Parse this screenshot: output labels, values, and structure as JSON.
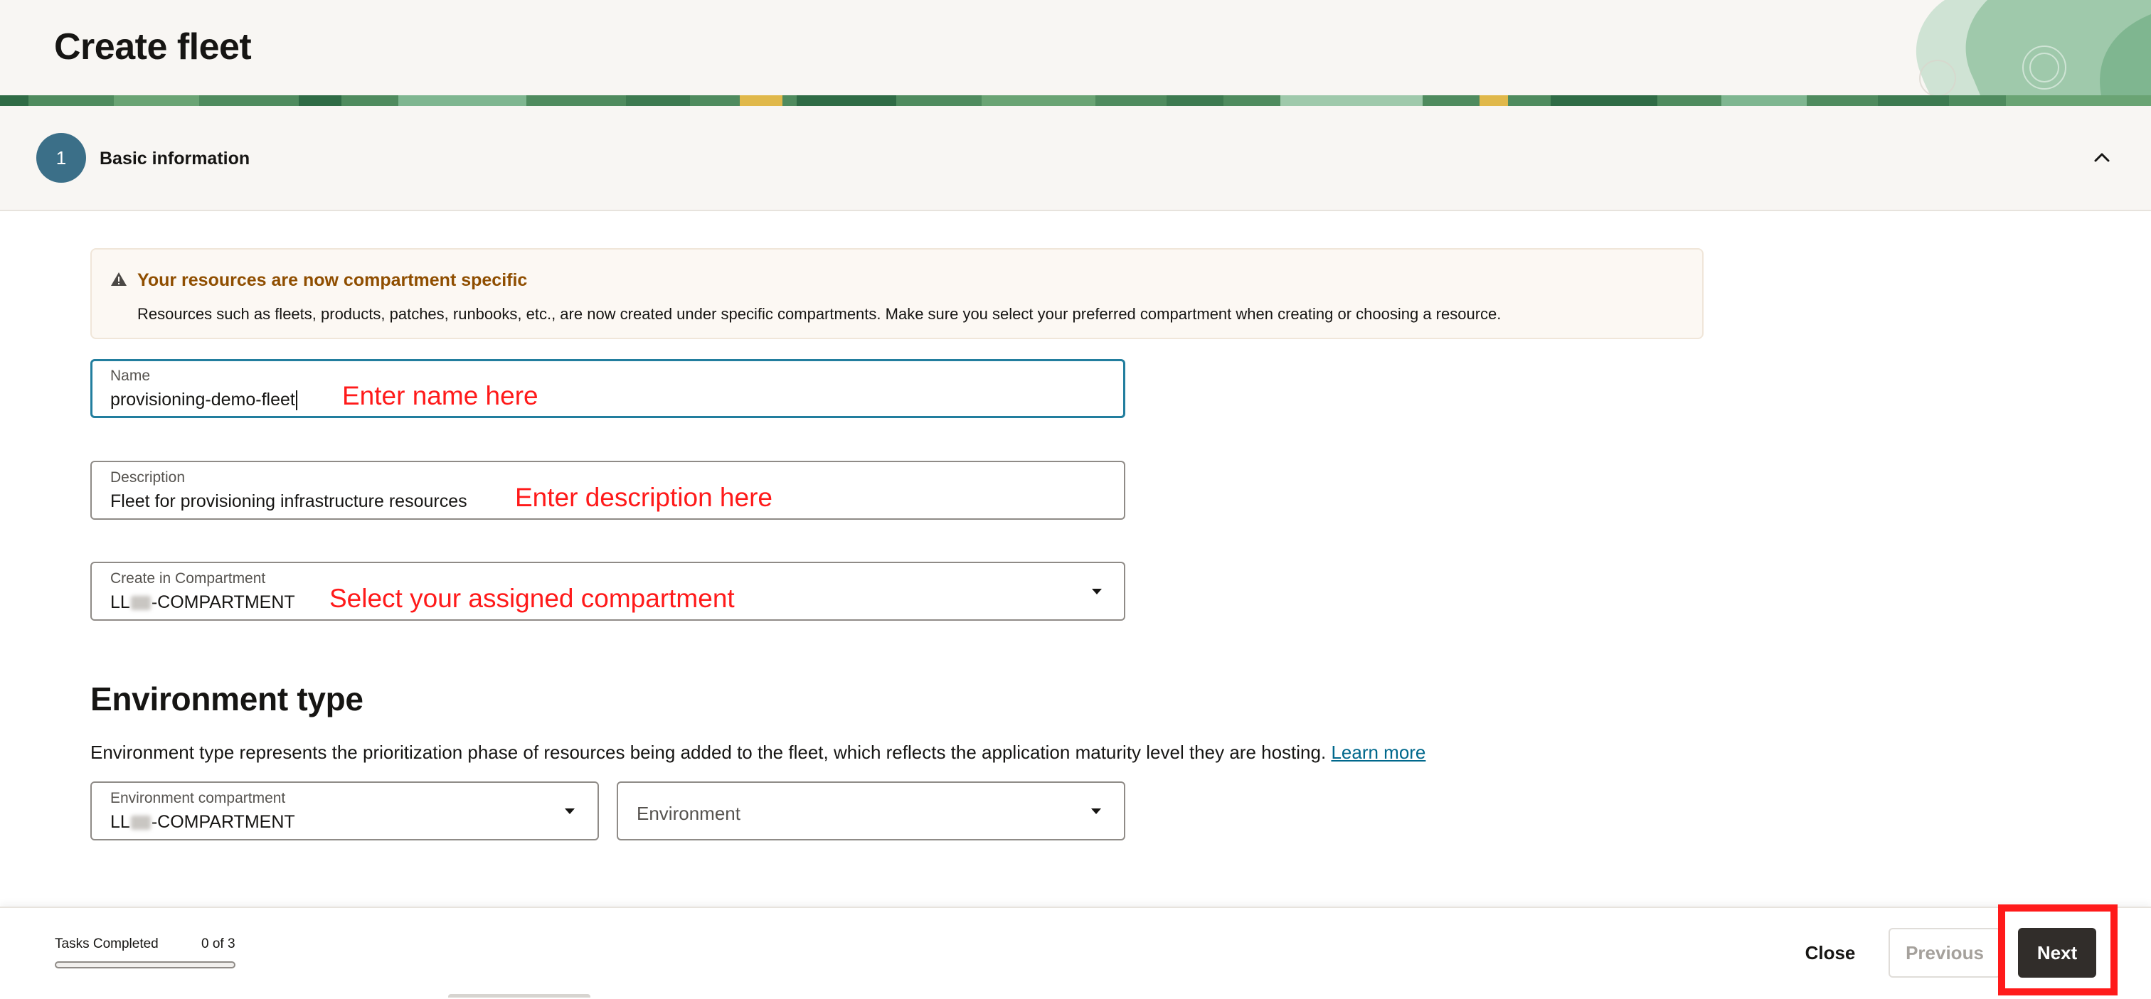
{
  "page": {
    "title": "Create fleet"
  },
  "step": {
    "number": "1",
    "title": "Basic information"
  },
  "alert": {
    "title": "Your resources are now compartment specific",
    "body": "Resources such as fleets, products, patches, runbooks, etc., are now created under specific compartments. Make sure you select your preferred compartment when creating or choosing a resource."
  },
  "form": {
    "name": {
      "label": "Name",
      "value": "provisioning-demo-fleet",
      "annotation": "Enter name here"
    },
    "description": {
      "label": "Description",
      "value": "Fleet for provisioning infrastructure resources",
      "annotation": "Enter description here"
    },
    "compartment": {
      "label": "Create in Compartment",
      "value_prefix": "LL",
      "value_suffix": "-COMPARTMENT",
      "annotation": "Select your assigned compartment"
    }
  },
  "environment": {
    "title": "Environment type",
    "description": "Environment type represents the prioritization phase of resources being added to the fleet, which reflects the application maturity level they are hosting.",
    "learn_more": "Learn more",
    "compartment": {
      "label": "Environment compartment",
      "value_prefix": "LL",
      "value_suffix": "-COMPARTMENT"
    },
    "environment_select": {
      "placeholder": "Environment"
    }
  },
  "footer": {
    "tasks_label": "Tasks Completed",
    "tasks_count": "0 of 3",
    "progress_fraction": 0,
    "close_label": "Close",
    "previous_label": "Previous",
    "next_label": "Next"
  },
  "colors": {
    "annotation": "#ff1a1a",
    "step_circle": "#3b6f88",
    "alert_title": "#8f4e00",
    "focus_border": "#227e9e",
    "link": "#00688c",
    "primary_button": "#312d2a"
  }
}
